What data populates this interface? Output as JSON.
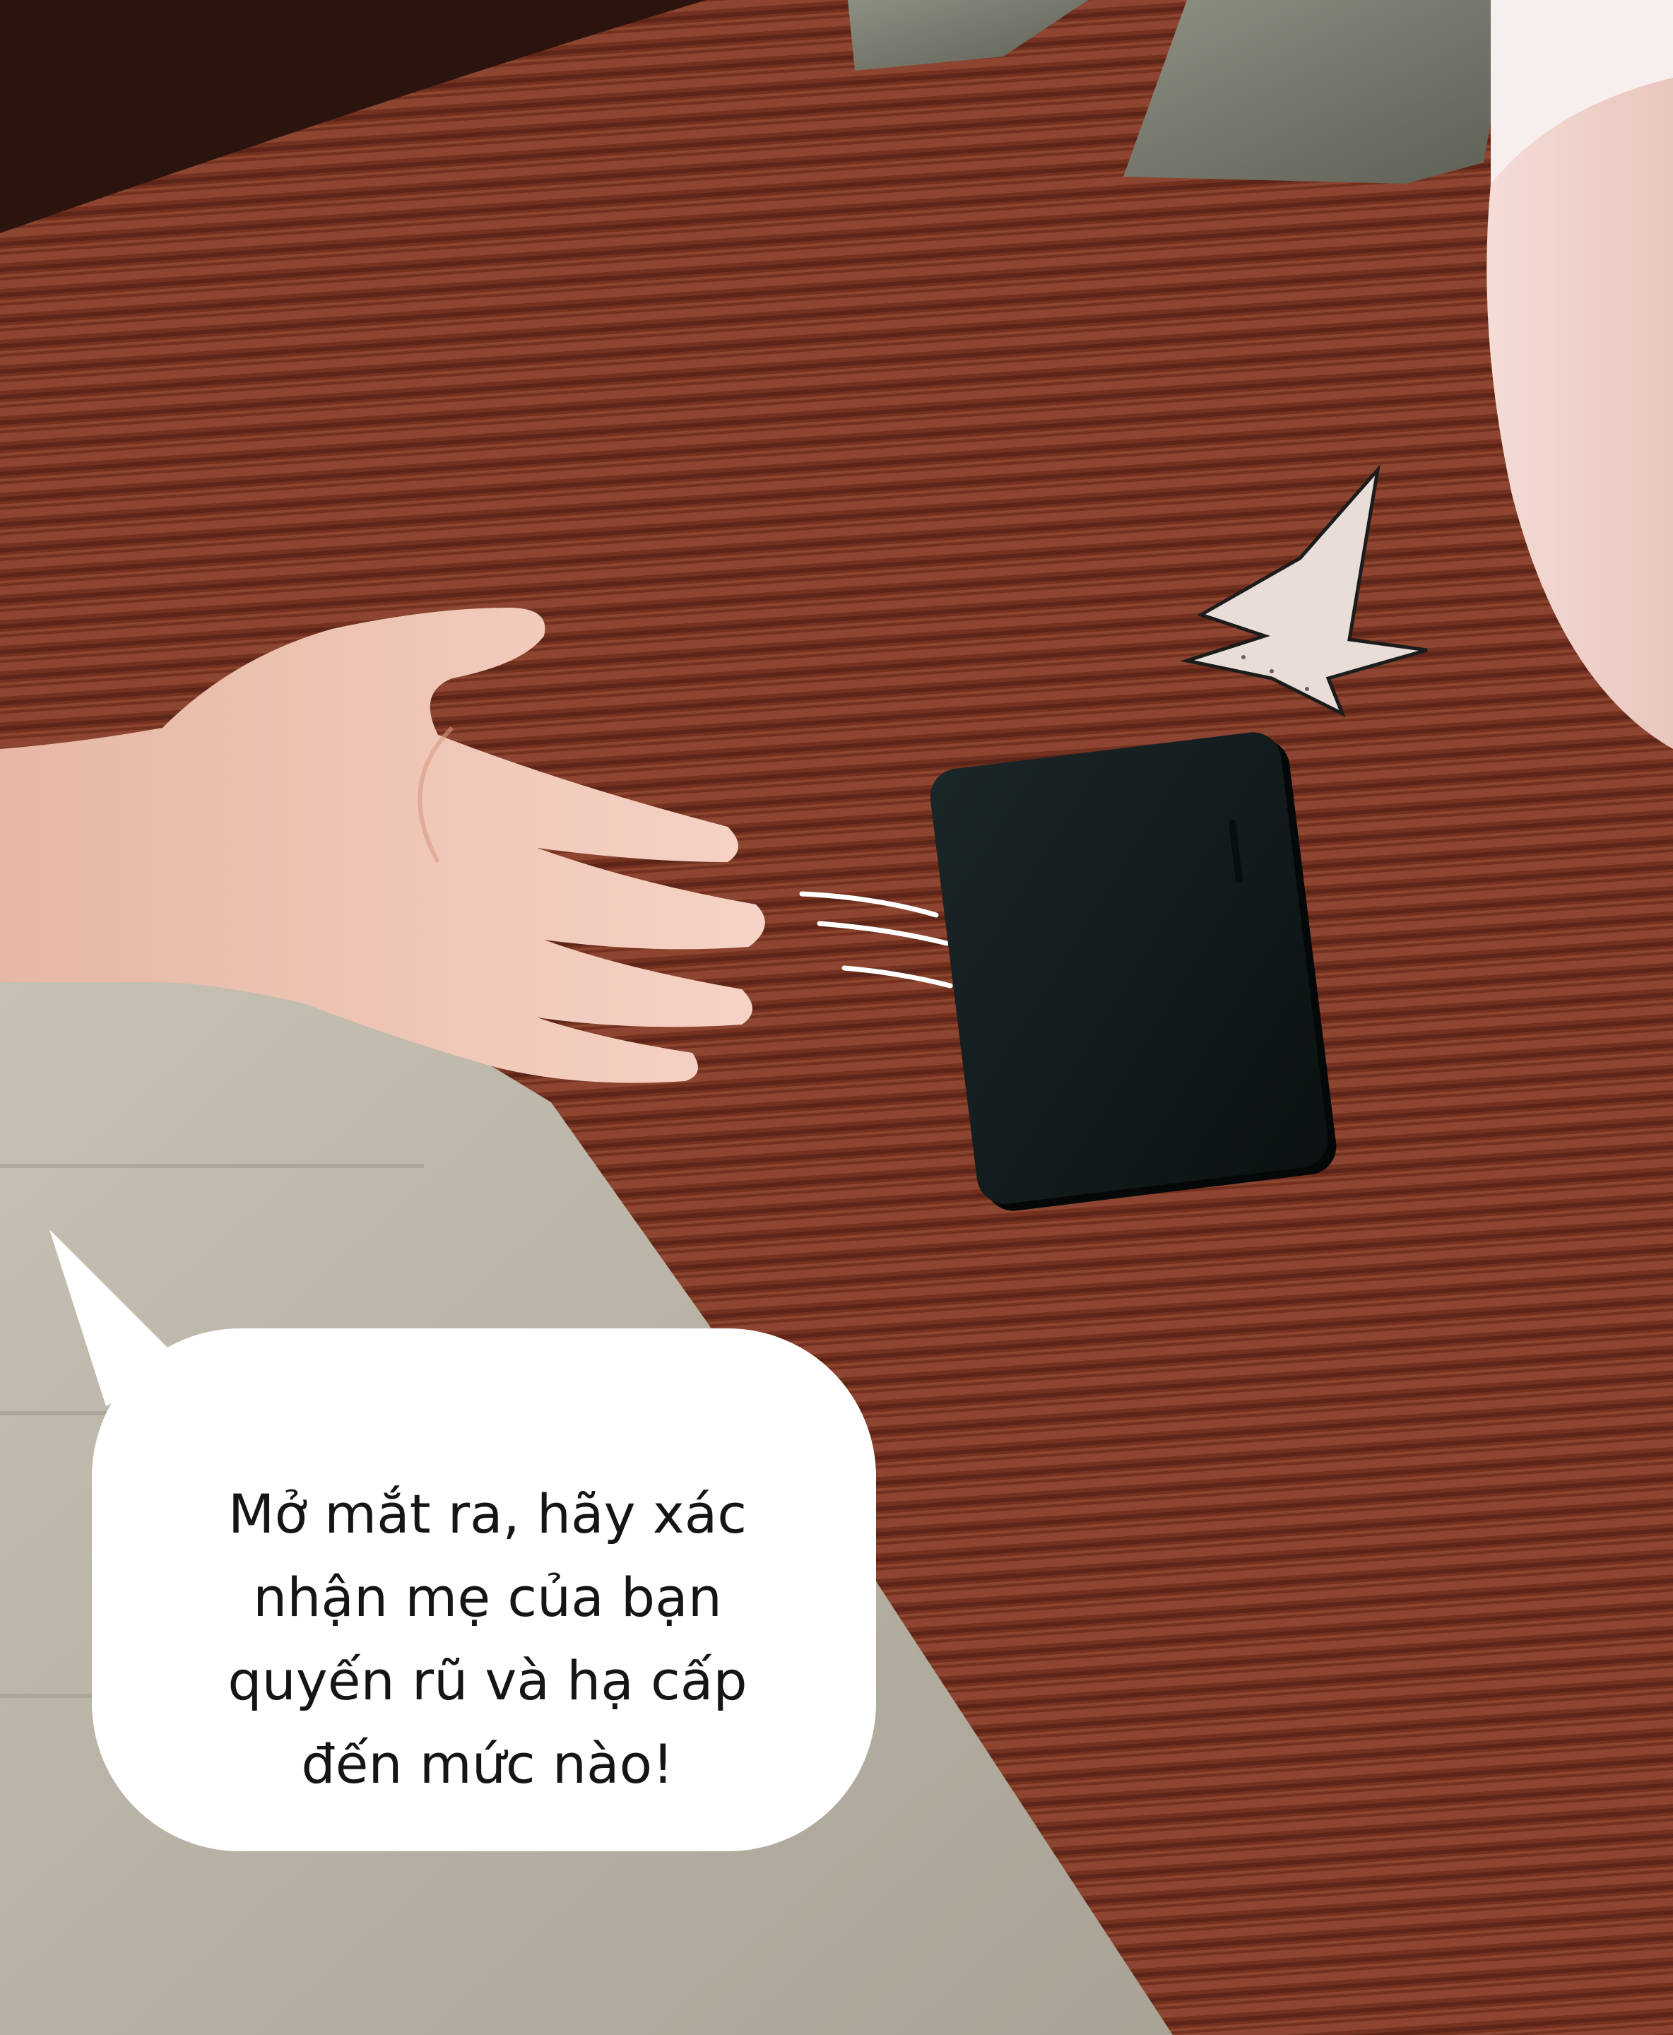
{
  "panel": {
    "speech_bubble": {
      "text": "Mở mắt ra, hãy xác\nnhận mẹ của bạn\nquyến rũ và hạ cấp\nđến mức nào!"
    },
    "phone": {
      "icon": "smartphone-icon"
    },
    "effects": {
      "impact": "impact-burst-icon",
      "motion": "motion-lines-icon"
    },
    "colors": {
      "carpet": "#7a3424",
      "carpet_light": "#9a4a34",
      "floor": "#b9b4a6",
      "skin": "#f0c4b4",
      "phone": "#0f1618",
      "bubble": "#ffffff"
    }
  }
}
